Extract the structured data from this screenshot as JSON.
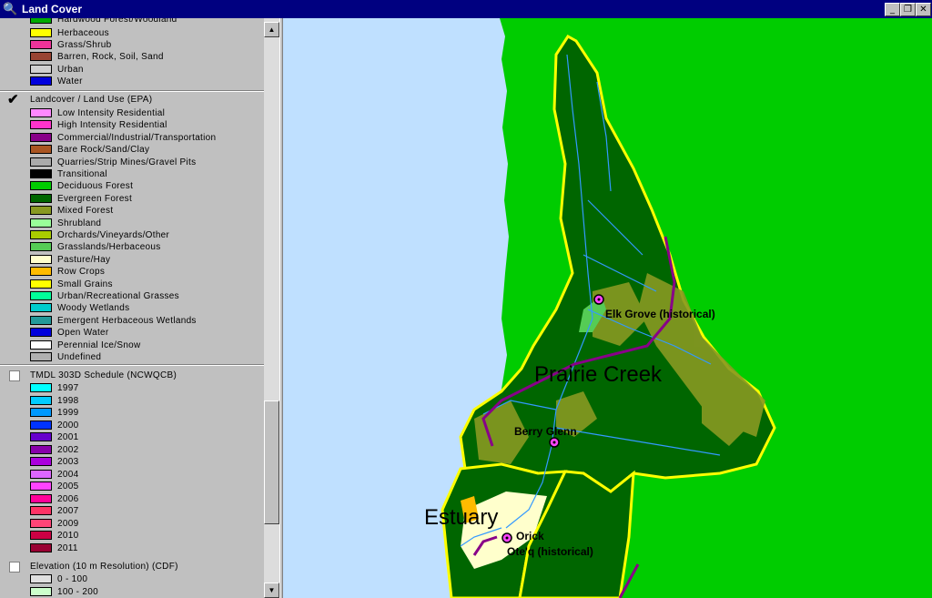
{
  "window": {
    "title": "Land Cover",
    "controls": [
      "_",
      "❐",
      "✕"
    ]
  },
  "toc": {
    "top_partial_label": "Hardwood Forest/Woodland",
    "group0_items": [
      {
        "label": "Herbaceous",
        "color": "#ffff00"
      },
      {
        "label": "Grass/Shrub",
        "color": "#ee3399"
      },
      {
        "label": "Barren, Rock, Soil, Sand",
        "color": "#994433"
      },
      {
        "label": "Urban",
        "color": "#d0d0d0"
      },
      {
        "label": "Water",
        "color": "#0000dd"
      }
    ],
    "layers": [
      {
        "name": "Landcover / Land Use (EPA)",
        "checked": true,
        "items": [
          {
            "label": "Low Intensity Residential",
            "color": "#ff88ff"
          },
          {
            "label": "High Intensity Residential",
            "color": "#ff33cc"
          },
          {
            "label": "Commercial/Industrial/Transportation",
            "color": "#880088"
          },
          {
            "label": "Bare Rock/Sand/Clay",
            "color": "#aa5522"
          },
          {
            "label": "Quarries/Strip Mines/Gravel Pits",
            "color": "#aaaaaa"
          },
          {
            "label": "Transitional",
            "color": "#000000"
          },
          {
            "label": "Deciduous Forest",
            "color": "#00cc00"
          },
          {
            "label": "Evergreen Forest",
            "color": "#006600"
          },
          {
            "label": "Mixed Forest",
            "color": "#889922"
          },
          {
            "label": "Shrubland",
            "color": "#99ff99"
          },
          {
            "label": "Orchards/Vineyards/Other",
            "color": "#aacc00"
          },
          {
            "label": "Grasslands/Herbaceous",
            "color": "#55cc55"
          },
          {
            "label": "Pasture/Hay",
            "color": "#ffffcc"
          },
          {
            "label": "Row Crops",
            "color": "#ffbb00"
          },
          {
            "label": "Small Grains",
            "color": "#ffff00"
          },
          {
            "label": "Urban/Recreational Grasses",
            "color": "#00ff99"
          },
          {
            "label": "Woody Wetlands",
            "color": "#00cccc"
          },
          {
            "label": "Emergent Herbaceous Wetlands",
            "color": "#229999"
          },
          {
            "label": "Open Water",
            "color": "#0000dd"
          },
          {
            "label": "Perennial Ice/Snow",
            "color": "#ffffff"
          },
          {
            "label": "Undefined",
            "color": "#b0b0b0"
          }
        ]
      },
      {
        "name": "TMDL 303D Schedule (NCWQCB)",
        "checked": false,
        "items": [
          {
            "label": "1997",
            "color": "#00ffff"
          },
          {
            "label": "1998",
            "color": "#00ccff"
          },
          {
            "label": "1999",
            "color": "#0099ff"
          },
          {
            "label": "2000",
            "color": "#0033ff"
          },
          {
            "label": "2001",
            "color": "#6600cc"
          },
          {
            "label": "2002",
            "color": "#8800aa"
          },
          {
            "label": "2003",
            "color": "#aa00dd"
          },
          {
            "label": "2004",
            "color": "#dd66ff"
          },
          {
            "label": "2005",
            "color": "#ff44ff"
          },
          {
            "label": "2006",
            "color": "#ff0099"
          },
          {
            "label": "2007",
            "color": "#ff3366"
          },
          {
            "label": "2009",
            "color": "#ff4477"
          },
          {
            "label": "2010",
            "color": "#cc0044"
          },
          {
            "label": "2011",
            "color": "#990033"
          }
        ]
      },
      {
        "name": "Elevation (10 m Resolution) (CDF)",
        "checked": false,
        "items": [
          {
            "label": "0 - 100",
            "color": "#e0e0e0"
          },
          {
            "label": "100 - 200",
            "color": "#ccffcc"
          }
        ]
      }
    ]
  },
  "map": {
    "places": [
      {
        "name": "Elk Grove (historical)"
      },
      {
        "name": "Berry Glenn"
      },
      {
        "name": "Orick"
      },
      {
        "name": "Ote'q (historical)"
      }
    ],
    "regions": [
      {
        "name": "Prairie Creek"
      },
      {
        "name": "Estuary"
      }
    ],
    "colors": {
      "ocean": "#bfe0ff",
      "background_green": "#00cc00",
      "forest": "#006600",
      "mixed": "#889922",
      "boundary": "#ffff00",
      "stream": "#3399ff",
      "road": "#880088"
    }
  }
}
